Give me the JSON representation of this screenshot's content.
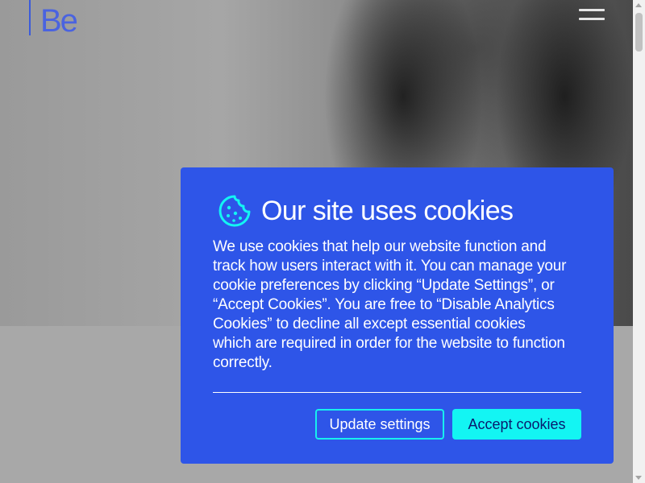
{
  "header": {
    "logo_text": "Be",
    "menu_icon": "hamburger-menu-icon"
  },
  "cookie_dialog": {
    "icon": "cookie-icon",
    "title": "Our site uses cookies",
    "body": "We use cookies that help our website function and track how users interact with it. You can manage your cookie preferences by clicking “Update Settings”, or “Accept Cookies”. You are free to “Disable Analytics Cookies” to decline all except essential cookies which are required in order for the website to function correctly.",
    "update_button": "Update settings",
    "accept_button": "Accept cookies"
  },
  "colors": {
    "dialog_bg": "#2e55e8",
    "accent_cyan": "#13f5f3",
    "logo_blue": "#4a63e0"
  }
}
